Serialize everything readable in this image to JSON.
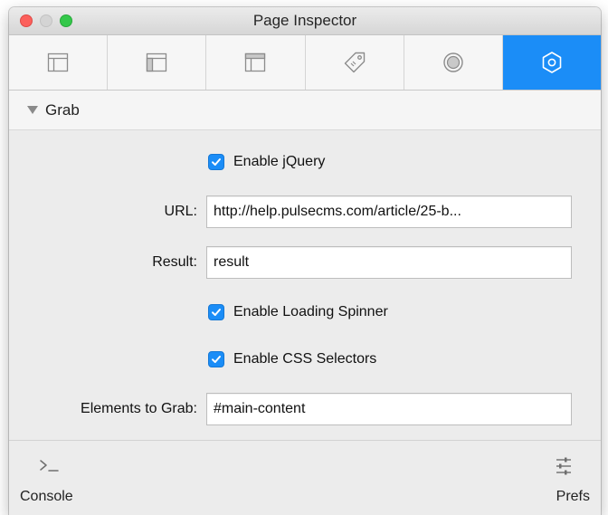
{
  "window": {
    "title": "Page Inspector"
  },
  "tabs": [
    {
      "icon": "layout-sidebar-icon",
      "active": false
    },
    {
      "icon": "layout-panel-icon",
      "active": false
    },
    {
      "icon": "layout-header-icon",
      "active": false
    },
    {
      "icon": "tag-icon",
      "active": false
    },
    {
      "icon": "record-icon",
      "active": false
    },
    {
      "icon": "hexagon-gear-icon",
      "active": true
    }
  ],
  "section": {
    "title": "Grab",
    "expanded": true
  },
  "form": {
    "enable_jquery": {
      "label": "Enable jQuery",
      "checked": true
    },
    "url": {
      "label": "URL:",
      "value": "http://help.pulsecms.com/article/25-b..."
    },
    "result": {
      "label": "Result:",
      "value": "result"
    },
    "enable_spinner": {
      "label": "Enable Loading Spinner",
      "checked": true
    },
    "enable_css": {
      "label": "Enable CSS Selectors",
      "checked": true
    },
    "elements": {
      "label": "Elements to Grab:",
      "value": "#main-content"
    }
  },
  "footer": {
    "console_label": "Console",
    "prefs_label": "Prefs"
  },
  "colors": {
    "accent": "#1b8df7",
    "close": "#fc605c",
    "zoom": "#34c84a"
  }
}
